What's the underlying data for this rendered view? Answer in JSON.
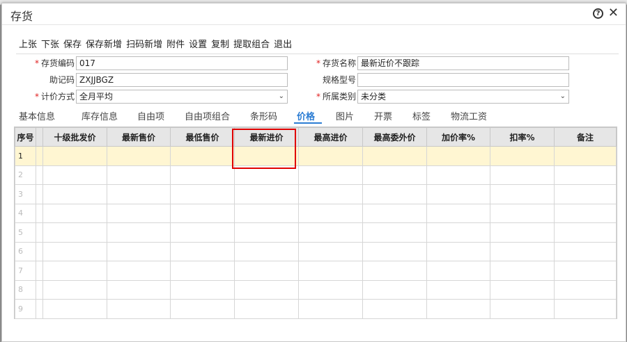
{
  "window": {
    "title": "存货"
  },
  "toolbar": {
    "buttons": [
      "上张",
      "下张",
      "保存",
      "保存新增",
      "扫码新增",
      "附件",
      "设置",
      "复制",
      "提取组合",
      "退出"
    ]
  },
  "form": {
    "code_label": "存货编码",
    "code_value": "017",
    "name_label": "存货名称",
    "name_value": "最新近价不跟踪",
    "mnemonic_label": "助记码",
    "mnemonic_value": "ZXJJBGZ",
    "spec_label": "规格型号",
    "spec_value": "",
    "pricing_label": "计价方式",
    "pricing_value": "全月平均",
    "category_label": "所属类别",
    "category_value": "未分类",
    "required_mark": "*"
  },
  "tabs": [
    "基本信息",
    "库存信息",
    "自由项",
    "自由项组合",
    "条形码",
    "价格",
    "图片",
    "开票",
    "标签",
    "物流工资"
  ],
  "active_tab": "价格",
  "grid": {
    "headers": [
      "序号",
      "十级批发价",
      "最新售价",
      "最低售价",
      "最新进价",
      "最高进价",
      "最高委外价",
      "加价率%",
      "扣率%",
      "备注"
    ],
    "row_numbers": [
      "1",
      "2",
      "3",
      "4",
      "5",
      "6",
      "7",
      "8",
      "9"
    ],
    "active_row": 1
  },
  "colors": {
    "accent": "#2b7cd3",
    "active_row": "#fff6d2",
    "highlight": "#e00000",
    "required": "#e02020"
  },
  "icons": {
    "help": "help-icon",
    "close": "close-icon",
    "dropdown": "chevron-down-icon"
  }
}
